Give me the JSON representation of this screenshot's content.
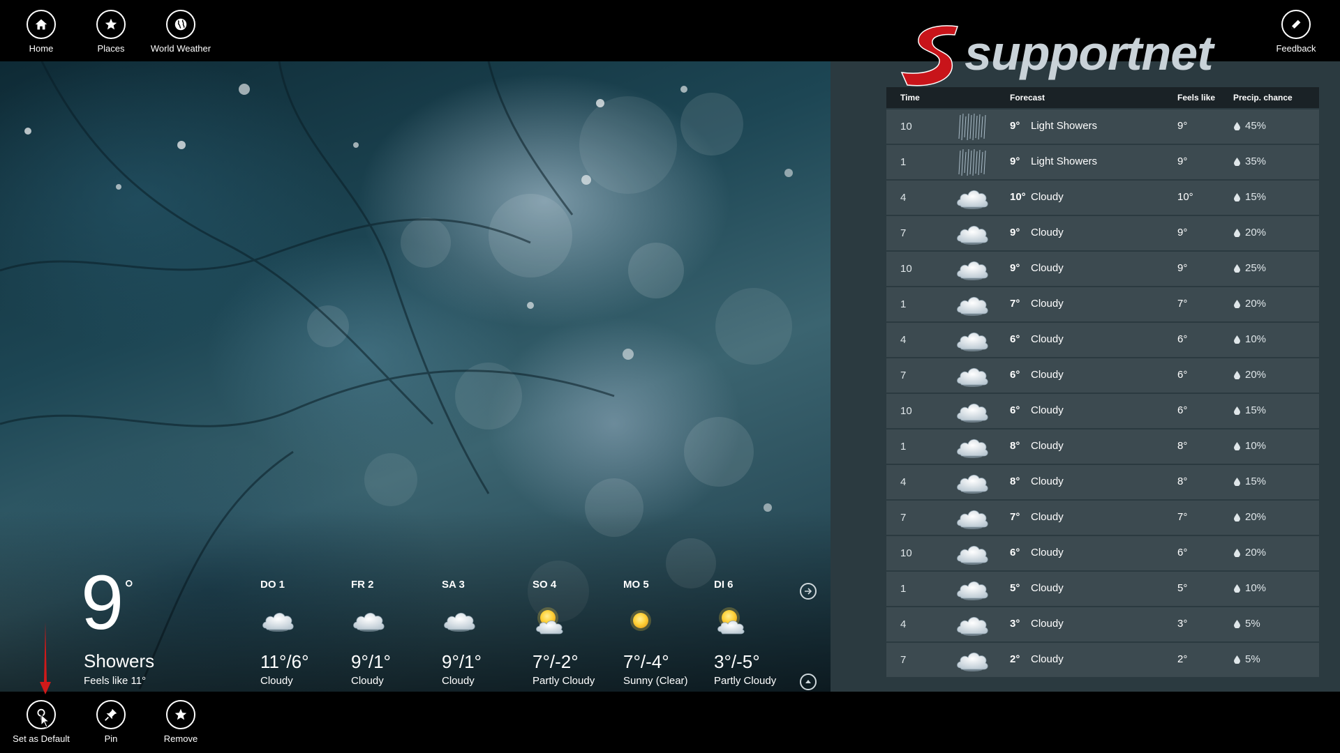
{
  "topbar": {
    "home_label": "Home",
    "places_label": "Places",
    "world_label": "World Weather",
    "feedback_label": "Feedback"
  },
  "bottombar": {
    "default_label": "Set as Default",
    "pin_label": "Pin",
    "remove_label": "Remove"
  },
  "logo": {
    "text": "supportnet",
    "color": "#d01a1a"
  },
  "current": {
    "temp": "9",
    "deg": "°",
    "condition": "Showers",
    "feels_like": "Feels like 11°"
  },
  "daily": [
    {
      "day": "DO 1",
      "temp": "11°/6°",
      "cond": "Cloudy",
      "icon": "cloud-icon"
    },
    {
      "day": "FR 2",
      "temp": "9°/1°",
      "cond": "Cloudy",
      "icon": "cloud-icon"
    },
    {
      "day": "SA 3",
      "temp": "9°/1°",
      "cond": "Cloudy",
      "icon": "cloud-icon"
    },
    {
      "day": "SO 4",
      "temp": "7°/-2°",
      "cond": "Partly Cloudy",
      "icon": "partly-cloudy-icon"
    },
    {
      "day": "MO 5",
      "temp": "7°/-4°",
      "cond": "Sunny (Clear)",
      "icon": "sun-icon"
    },
    {
      "day": "DI 6",
      "temp": "3°/-5°",
      "cond": "Partly Cloudy",
      "icon": "partly-cloudy-icon"
    }
  ],
  "hourly": {
    "headers": {
      "time": "Time",
      "forecast": "Forecast",
      "feels": "Feels like",
      "precip": "Precip. chance"
    },
    "rows": [
      {
        "time": "10",
        "temp": "9°",
        "desc": "Light Showers",
        "feels": "9°",
        "precip": "45%",
        "icon": "showers-icon"
      },
      {
        "time": "1",
        "temp": "9°",
        "desc": "Light Showers",
        "feels": "9°",
        "precip": "35%",
        "icon": "showers-icon"
      },
      {
        "time": "4",
        "temp": "10°",
        "desc": "Cloudy",
        "feels": "10°",
        "precip": "15%",
        "icon": "cloud-icon"
      },
      {
        "time": "7",
        "temp": "9°",
        "desc": "Cloudy",
        "feels": "9°",
        "precip": "20%",
        "icon": "cloud-icon"
      },
      {
        "time": "10",
        "temp": "9°",
        "desc": "Cloudy",
        "feels": "9°",
        "precip": "25%",
        "icon": "cloud-icon"
      },
      {
        "time": "1",
        "temp": "7°",
        "desc": "Cloudy",
        "feels": "7°",
        "precip": "20%",
        "icon": "cloud-icon"
      },
      {
        "time": "4",
        "temp": "6°",
        "desc": "Cloudy",
        "feels": "6°",
        "precip": "10%",
        "icon": "cloud-icon"
      },
      {
        "time": "7",
        "temp": "6°",
        "desc": "Cloudy",
        "feels": "6°",
        "precip": "20%",
        "icon": "cloud-icon"
      },
      {
        "time": "10",
        "temp": "6°",
        "desc": "Cloudy",
        "feels": "6°",
        "precip": "15%",
        "icon": "cloud-icon"
      },
      {
        "time": "1",
        "temp": "8°",
        "desc": "Cloudy",
        "feels": "8°",
        "precip": "10%",
        "icon": "cloud-icon"
      },
      {
        "time": "4",
        "temp": "8°",
        "desc": "Cloudy",
        "feels": "8°",
        "precip": "15%",
        "icon": "cloud-icon"
      },
      {
        "time": "7",
        "temp": "7°",
        "desc": "Cloudy",
        "feels": "7°",
        "precip": "20%",
        "icon": "cloud-icon"
      },
      {
        "time": "10",
        "temp": "6°",
        "desc": "Cloudy",
        "feels": "6°",
        "precip": "20%",
        "icon": "cloud-icon"
      },
      {
        "time": "1",
        "temp": "5°",
        "desc": "Cloudy",
        "feels": "5°",
        "precip": "10%",
        "icon": "cloud-icon"
      },
      {
        "time": "4",
        "temp": "3°",
        "desc": "Cloudy",
        "feels": "3°",
        "precip": "5%",
        "icon": "cloud-icon"
      },
      {
        "time": "7",
        "temp": "2°",
        "desc": "Cloudy",
        "feels": "2°",
        "precip": "5%",
        "icon": "cloud-icon"
      }
    ]
  },
  "colors": {
    "panel": "#2b3a40",
    "row": "#3c4a50",
    "header": "#1a2226",
    "accent_red": "#d01a1a",
    "sun": "#ffd23a"
  }
}
